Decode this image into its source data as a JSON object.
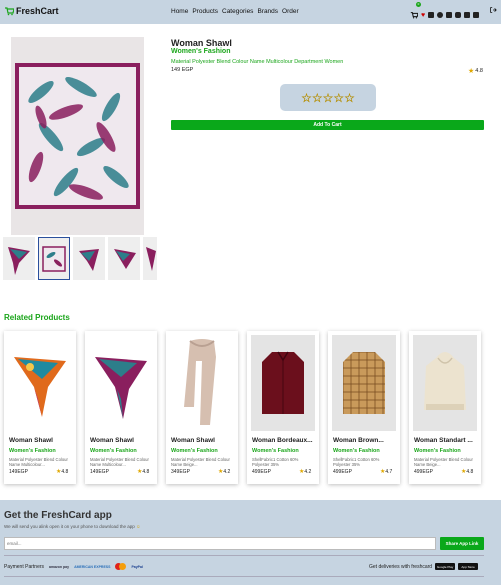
{
  "brand": {
    "name": "FreshCart"
  },
  "nav": {
    "links": [
      "Home",
      "Products",
      "Categories",
      "Brands",
      "Order"
    ],
    "cart_count": "0"
  },
  "product": {
    "title": "Woman Shawl",
    "category": "Women's Fashion",
    "description": "Material Polyester Blend Colour Name Multicolour Department Women",
    "price": "149 EGP",
    "rating": "4.8",
    "add_to_cart": "Add To Cart"
  },
  "related": {
    "heading": "Related Products",
    "items": [
      {
        "title": "Woman Shawl",
        "category": "Women's Fashion",
        "desc": "Material Polyester Blend Colour Name Multicolour...",
        "price": "149EGP",
        "rating": "4.8"
      },
      {
        "title": "Woman Shawl",
        "category": "Women's Fashion",
        "desc": "Material Polyester Blend Colour Name Multicolour...",
        "price": "149EGP",
        "rating": "4.8"
      },
      {
        "title": "Woman Shawl",
        "category": "Women's Fashion",
        "desc": "Material Polyester Blend Colour Name Beige...",
        "price": "349EGP",
        "rating": "4.2"
      },
      {
        "title": "Woman Bordeaux...",
        "category": "Women's Fashion",
        "desc": "ShellFabric1 Cotton 60% Polyester 35%",
        "price": "499EGP",
        "rating": "4.2"
      },
      {
        "title": "Woman Brown...",
        "category": "Women's Fashion",
        "desc": "ShellFabric1 Cotton 60% Polyester 35%",
        "price": "499EGP",
        "rating": "4.7"
      },
      {
        "title": "Woman Standart ...",
        "category": "Women's Fashion",
        "desc": "Material Polyester Blend Colour Name Beige...",
        "price": "499EGP",
        "rating": "4.8"
      }
    ]
  },
  "app": {
    "title": "Get the FreshCard app",
    "subtitle": "We will send you alink open it on your phone to download the app",
    "email_placeholder": "email...",
    "share": "Share App Link",
    "payment_label": "Payment Partners",
    "payment_logos": [
      "amazon pay",
      "AMERICAN EXPRESS",
      "PayPal"
    ],
    "deliveries": "Get deliveries with freshcard",
    "stores": [
      "Google Play",
      "App Store"
    ]
  }
}
